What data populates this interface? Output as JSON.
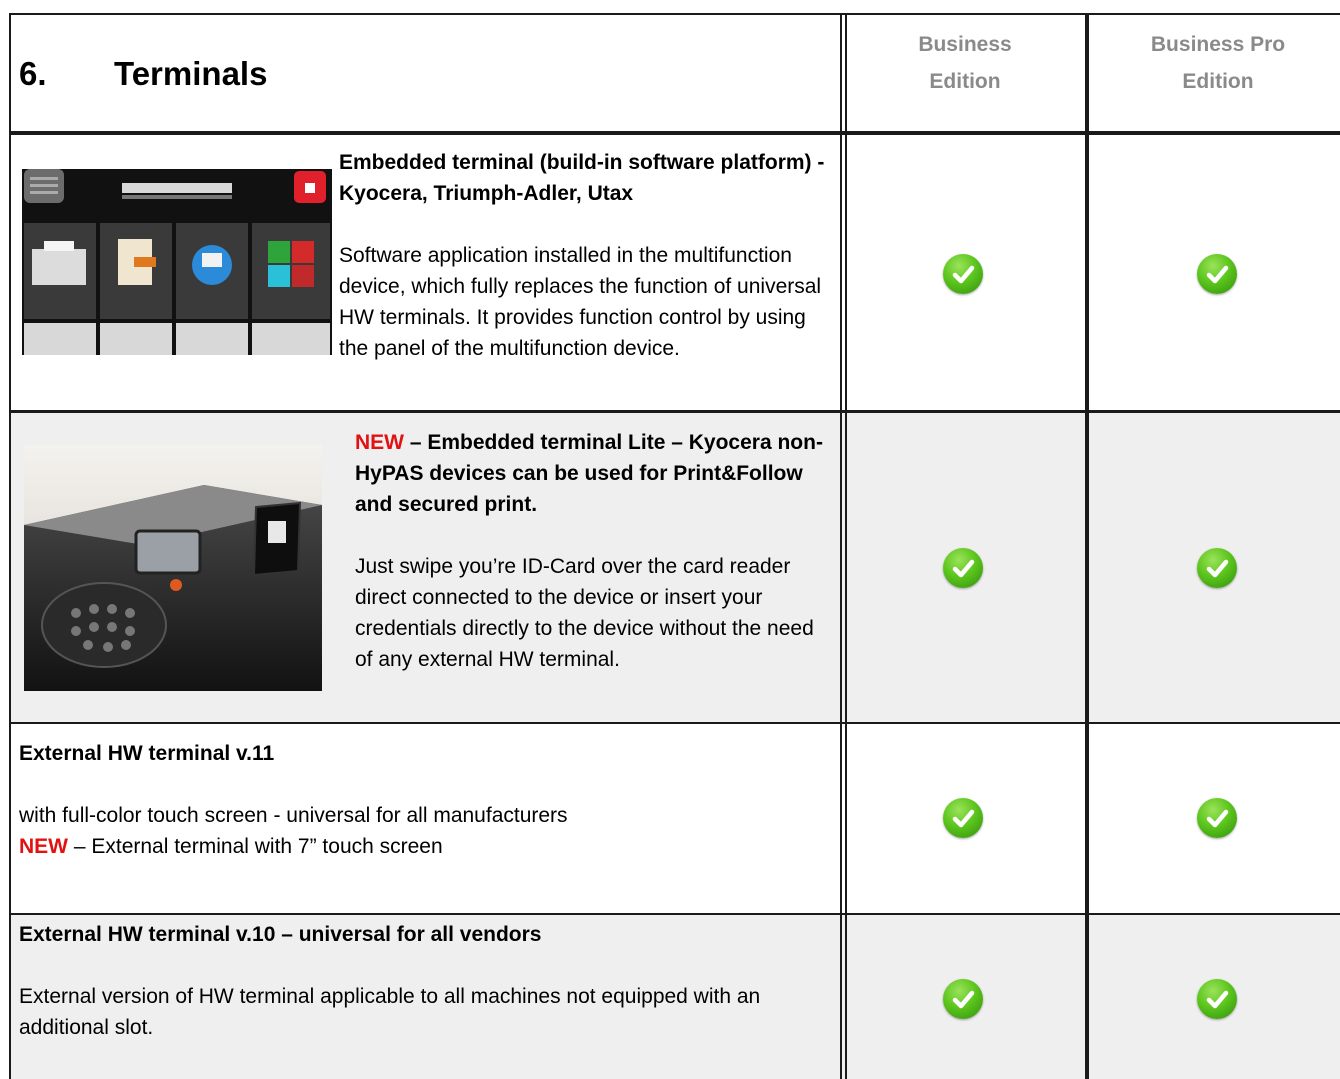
{
  "header": {
    "section_number": "6.",
    "section_title": "Terminals",
    "col1_line1": "Business",
    "col1_line2": "Edition",
    "col2_line1": "Business Pro",
    "col2_line2": "Edition"
  },
  "rows": [
    {
      "title": "Embedded terminal (build-in software platform) - Kyocera, Triumph-Adler, Utax",
      "body": "Software application installed in the multifunction device, which fully replaces the function of universal HW terminals. It provides function control by using the panel of the multifunction device.",
      "business": "included",
      "business_pro": "included"
    },
    {
      "new_tag": "NEW",
      "title": " – Embedded terminal Lite – Kyocera non-HyPAS devices can be used for Print&Follow and secured print.",
      "body": "Just swipe you’re ID-Card over the card reader direct connected to the device or insert your credentials directly to the device without the need of any external HW terminal.",
      "business": "included",
      "business_pro": "included"
    },
    {
      "title": "External HW terminal v.11",
      "body": "with full-color touch screen - universal for all manufacturers",
      "new_tag": "NEW",
      "body2": " – External terminal with 7” touch screen",
      "business": "included",
      "business_pro": "included"
    },
    {
      "title": "External HW terminal v.10 – universal for all vendors",
      "body": "External version of HW terminal applicable to all machines not equipped with an additional slot.",
      "business": "included",
      "business_pro": "included"
    }
  ],
  "colors": {
    "new": "#e01212",
    "header_text": "#8a8a8a",
    "shade": "#efefef",
    "check": "#5cc51d"
  }
}
